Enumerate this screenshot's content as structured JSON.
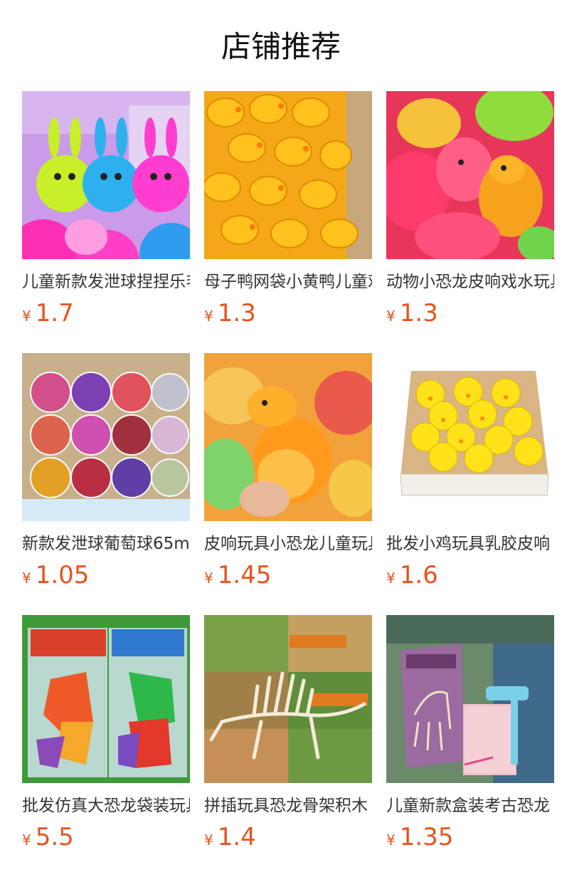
{
  "page": {
    "title": "店铺推荐"
  },
  "colors": {
    "price": "#e8531d",
    "title": "#111111",
    "product_name": "#333333"
  },
  "currency_symbol": "¥",
  "products": [
    {
      "name": "儿童新款发泄球捏捏乐毛毛球",
      "price": "1.7",
      "image": "colorful-rabbit-puffer-balls"
    },
    {
      "name": "母子鸭网袋小黄鸭儿童戏水玩具",
      "price": "1.3",
      "image": "yellow-rubber-ducks-in-net-bags"
    },
    {
      "name": "动物小恐龙皮响戏水玩具",
      "price": "1.3",
      "image": "squeaky-dinosaur-toys"
    },
    {
      "name": "新款发泄球葡萄球65mm",
      "price": "1.05",
      "image": "glitter-bouncy-balls-in-box"
    },
    {
      "name": "皮响玩具小恐龙儿童玩具",
      "price": "1.45",
      "image": "orange-dinosaur-squeeze-toy"
    },
    {
      "name": "批发小鸡玩具乳胶皮响",
      "price": "1.6",
      "image": "yellow-chick-puffer-toys-box"
    },
    {
      "name": "批发仿真大恐龙袋装玩具",
      "price": "5.5",
      "image": "bagged-dinosaur-figures"
    },
    {
      "name": "拼插玩具恐龙骨架积木",
      "price": "1.4",
      "image": "dinosaur-skeleton-puzzle"
    },
    {
      "name": "儿童新款盒装考古恐龙",
      "price": "1.35",
      "image": "boxed-archaeology-dig-kit"
    }
  ]
}
